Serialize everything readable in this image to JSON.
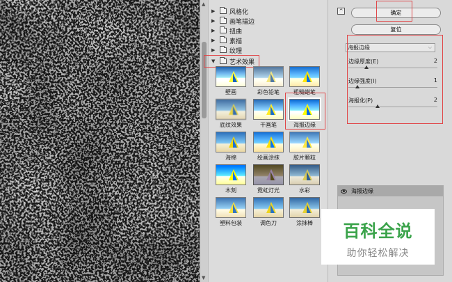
{
  "filter_folders": [
    {
      "label": "风格化",
      "expanded": false
    },
    {
      "label": "画笔描边",
      "expanded": false
    },
    {
      "label": "扭曲",
      "expanded": false
    },
    {
      "label": "素描",
      "expanded": false
    },
    {
      "label": "纹理",
      "expanded": false
    },
    {
      "label": "艺术效果",
      "expanded": true
    }
  ],
  "thumbnails": [
    {
      "label": "壁画"
    },
    {
      "label": "彩色铅笔"
    },
    {
      "label": "粗糙蜡笔"
    },
    {
      "label": "底纹效果"
    },
    {
      "label": "干画笔"
    },
    {
      "label": "海报边缘",
      "selected": true
    },
    {
      "label": "海绵"
    },
    {
      "label": "绘画涂抹"
    },
    {
      "label": "胶片颗粒"
    },
    {
      "label": "木刻"
    },
    {
      "label": "霓虹灯光"
    },
    {
      "label": "水彩"
    },
    {
      "label": "塑料包装"
    },
    {
      "label": "调色刀"
    },
    {
      "label": "涂抹棒"
    }
  ],
  "buttons": {
    "ok": "确定",
    "reset": "复位"
  },
  "filter_select": {
    "value": "海报边缘"
  },
  "params": [
    {
      "label": "边缘厚度(E)",
      "value": "2",
      "fraction": 0.2
    },
    {
      "label": "边缘强度(I)",
      "value": "1",
      "fraction": 0.1
    },
    {
      "label": "海报化(P)",
      "value": "2",
      "fraction": 0.33
    }
  ],
  "layer": {
    "label": "海报边缘"
  },
  "watermark": {
    "title": "百科全说",
    "subtitle": "助你轻松解决"
  },
  "colors": {
    "highlight": "#e0484a",
    "watermark_green": "#3aa34a"
  }
}
